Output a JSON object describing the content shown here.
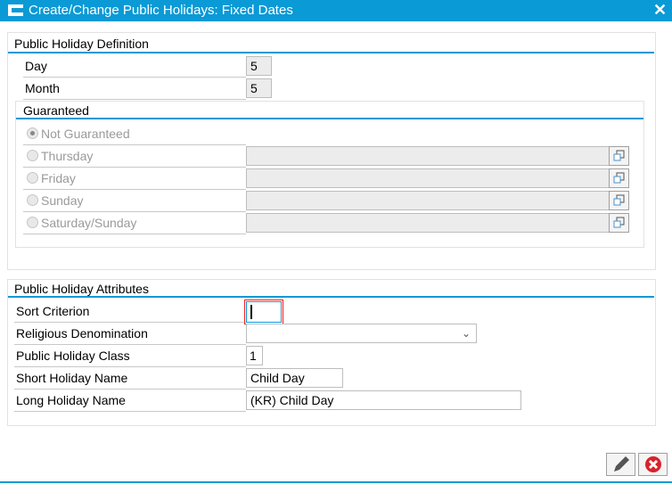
{
  "window": {
    "title": "Create/Change Public Holidays: Fixed Dates"
  },
  "definition": {
    "title": "Public Holiday Definition",
    "day_label": "Day",
    "day_value": "5",
    "month_label": "Month",
    "month_value": "5"
  },
  "guaranteed": {
    "title": "Guaranteed",
    "options": [
      {
        "label": "Not Guaranteed",
        "selected": true
      },
      {
        "label": "Thursday",
        "selected": false
      },
      {
        "label": "Friday",
        "selected": false
      },
      {
        "label": "Sunday",
        "selected": false
      },
      {
        "label": "Saturday/Sunday",
        "selected": false
      }
    ]
  },
  "attributes": {
    "title": "Public Holiday Attributes",
    "sort_label": "Sort Criterion",
    "sort_value": "",
    "religion_label": "Religious Denomination",
    "religion_value": "",
    "class_label": "Public Holiday Class",
    "class_value": "1",
    "short_label": "Short Holiday Name",
    "short_value": "Child Day",
    "long_label": "Long Holiday Name",
    "long_value": "(KR) Child Day"
  },
  "colors": {
    "accent": "#0a9ad6",
    "cancel": "#d9232a"
  }
}
